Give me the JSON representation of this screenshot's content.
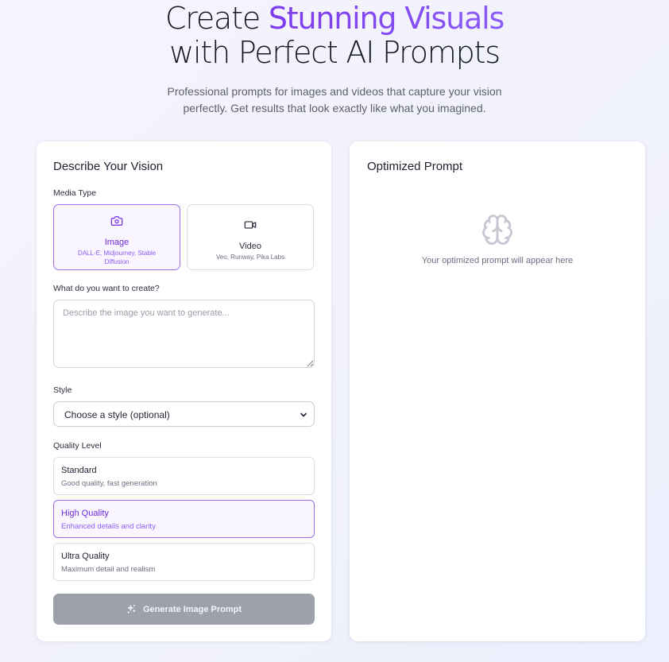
{
  "hero": {
    "title_line1_plain": "Create ",
    "title_line1_accent": "Stunning Visuals",
    "title_line2": "with Perfect AI Prompts",
    "subtitle_line1": "Professional prompts for images and videos that capture your vision",
    "subtitle_line2": "perfectly. Get results that look exactly like what you imagined.",
    "accent_color": "#7c3aed"
  },
  "form": {
    "title": "Describe Your Vision",
    "media_type_label": "Media Type",
    "media_options": [
      {
        "name": "Image",
        "sub": "DALL-E, Midjourney, Stable Diffusion",
        "icon": "camera-icon",
        "selected": true
      },
      {
        "name": "Video",
        "sub": "Veo, Runway, Pika Labs",
        "icon": "video-camera-icon",
        "selected": false
      }
    ],
    "create_label": "What do you want to create?",
    "create_placeholder": "Describe the image you want to generate...",
    "create_value": "",
    "style_label": "Style",
    "style_selected": "Choose a style (optional)",
    "quality_label": "Quality Level",
    "quality_options": [
      {
        "name": "Standard",
        "desc": "Good quality, fast generation",
        "selected": false
      },
      {
        "name": "High Quality",
        "desc": "Enhanced details and clarity",
        "selected": true
      },
      {
        "name": "Ultra Quality",
        "desc": "Maximum detail and realism",
        "selected": false
      }
    ],
    "generate_label": "Generate Image Prompt",
    "generate_icon": "sparkles-icon",
    "generate_disabled": true
  },
  "output": {
    "title": "Optimized Prompt",
    "placeholder_icon": "brain-icon",
    "placeholder_text": "Your optimized prompt will appear here"
  },
  "colors": {
    "selected_border": "#9a6ee6",
    "selected_bg": "#faf6ff",
    "button_disabled": "#9ca1ab"
  }
}
